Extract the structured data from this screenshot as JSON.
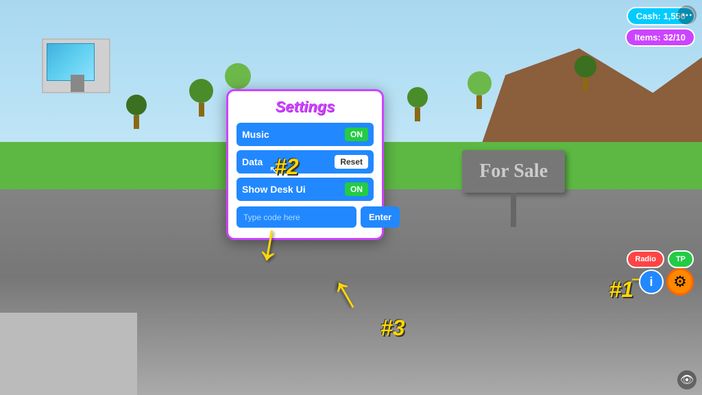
{
  "game": {
    "title": "Settings"
  },
  "settings": {
    "title": "Settings",
    "music_label": "Music",
    "music_toggle": "ON",
    "data_label": "Data",
    "data_reset": "Reset",
    "showdesk_label": "Show Desk Ui",
    "showdesk_toggle": "ON",
    "code_placeholder": "Type code here",
    "enter_label": "Enter"
  },
  "hud": {
    "cash_label": "Cash: 1,550",
    "items_label": "Items: 32/10",
    "radio_label": "Radio",
    "tp_label": "TP"
  },
  "annotations": {
    "num1": "#1",
    "num2": "#2",
    "num3": "#3"
  },
  "sign": {
    "text": "For Sale"
  },
  "icons": {
    "gear": "⚙",
    "eye": "👁",
    "dots": "⋯",
    "arrow_down": "↓",
    "arrow_up": "↑",
    "arrow_right": "→"
  }
}
